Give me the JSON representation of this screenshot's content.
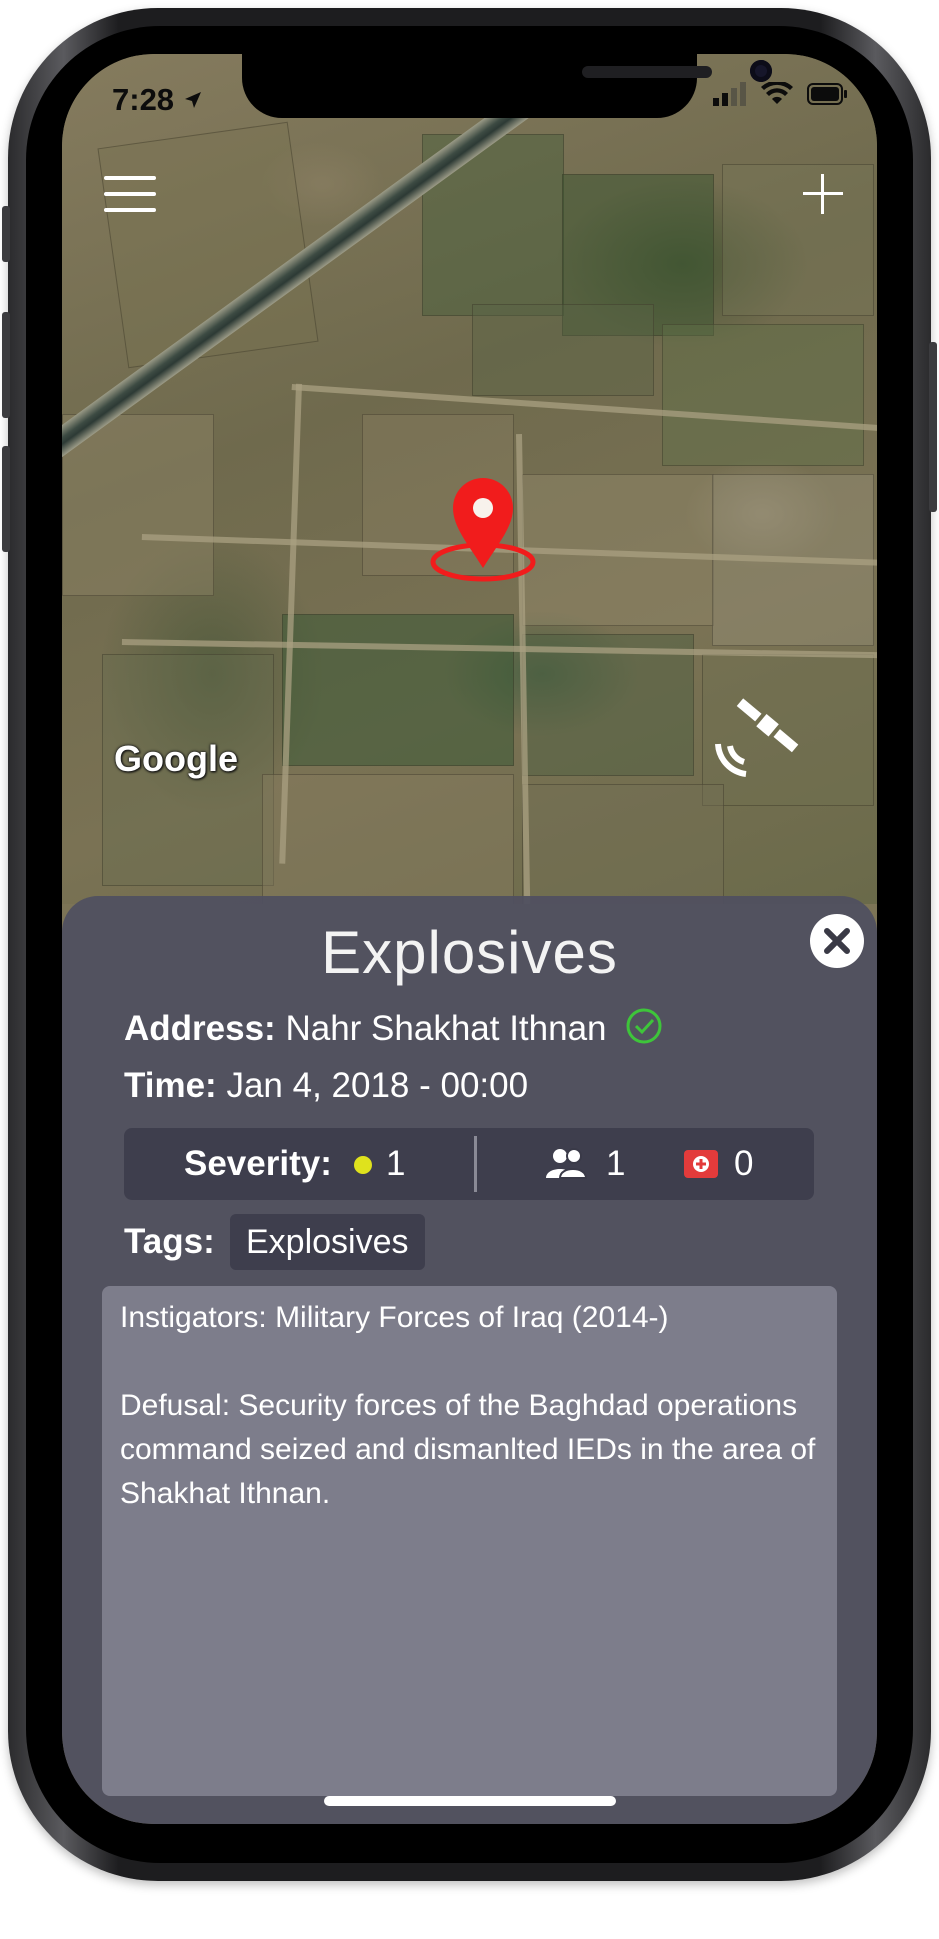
{
  "status_bar": {
    "time": "7:28"
  },
  "map": {
    "provider_logo": "Google"
  },
  "incident": {
    "title": "Explosives",
    "address_label": "Address:",
    "address": "Nahr Shakhat Ithnan",
    "time_label": "Time:",
    "time": "Jan 4, 2018 - 00:00",
    "severity_label": "Severity:",
    "severity": "1",
    "people": "1",
    "medical": "0",
    "tags_label": "Tags:",
    "tags": [
      "Explosives"
    ],
    "description_line1": "Instigators: Military Forces of Iraq (2014-)",
    "description_line2": "Defusal: Security forces of the Baghdad operations command seized and dismanlted IEDs in the area of Shakhat Ithnan."
  },
  "colors": {
    "pin": "#f11c1c",
    "severity_dot": "#dfe21d",
    "verified_check": "#3ec53a",
    "medical_badge": "#e33b3b",
    "panel_bg": "#505060"
  },
  "icons": [
    "menu-icon",
    "plus-icon",
    "location-pin-icon",
    "satellite-icon",
    "close-icon",
    "check-circle-icon",
    "people-icon",
    "medical-icon",
    "wifi-icon",
    "battery-icon",
    "signal-icon",
    "location-arrow-icon"
  ]
}
